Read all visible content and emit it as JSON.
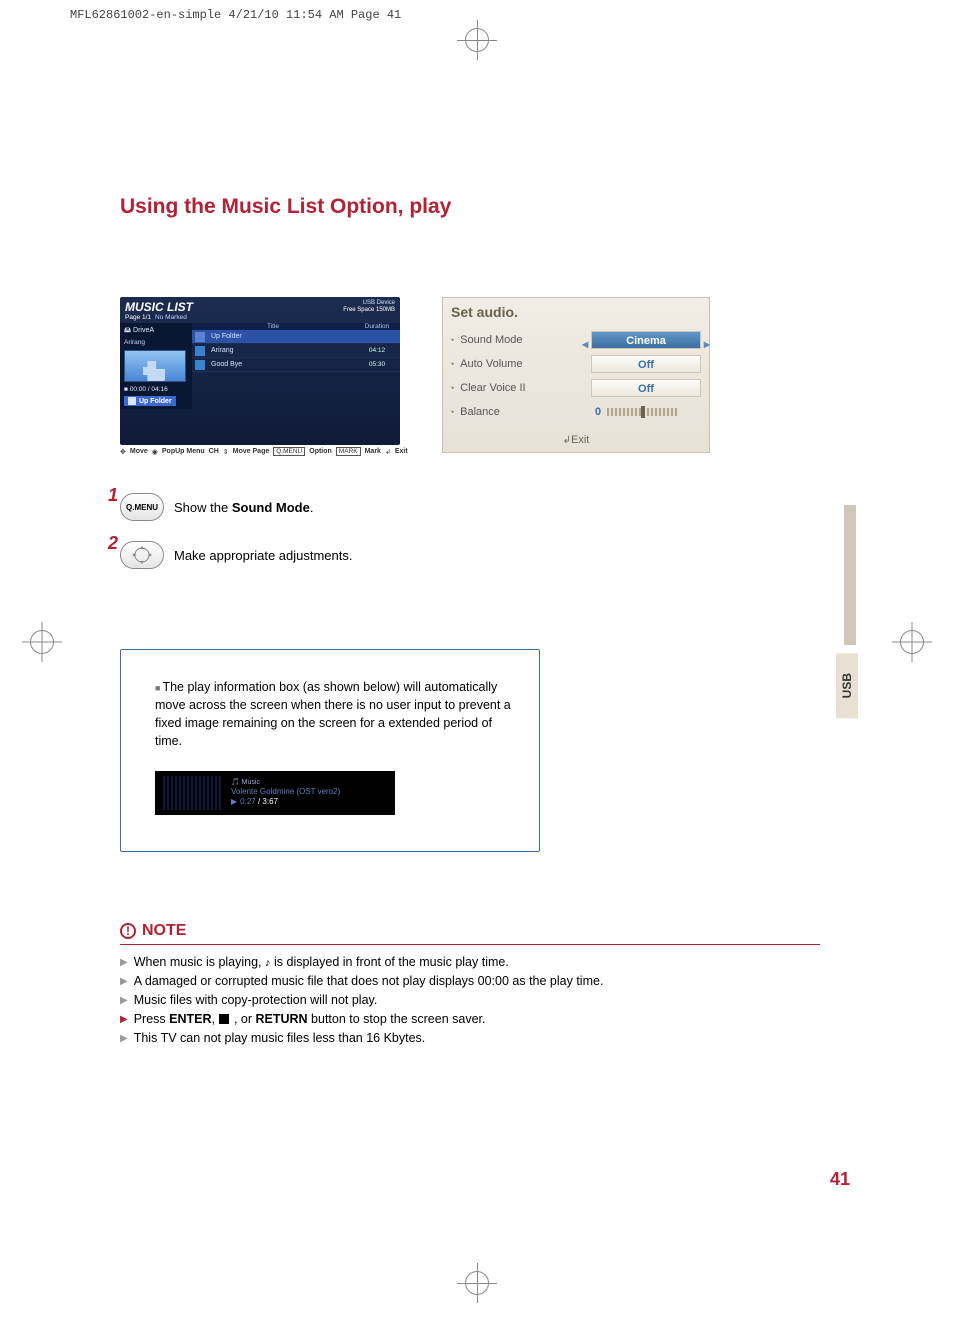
{
  "print_header": "MFL62861002-en-simple  4/21/10 11:54 AM  Page 41",
  "page_title": "Using the Music List Option, play",
  "side_tab": "USB",
  "page_number": "41",
  "music_panel": {
    "title": "MUSIC LIST",
    "page_info": "Page 1/1",
    "marked": "No Marked",
    "usb_label": "USB Device",
    "free_space": "Free Space 150MB",
    "drive_label": "DriveA",
    "drive_sub": "Arirang",
    "time_status": "■ 00:00 / 04:16",
    "up_folder_btn": "Up Folder",
    "col_title": "Title",
    "col_duration": "Duration",
    "rows": [
      {
        "name": "Up Folder",
        "duration": ""
      },
      {
        "name": "Arirang",
        "duration": "04:12"
      },
      {
        "name": "Good Bye",
        "duration": "05:30"
      }
    ],
    "hints": {
      "move": "Move",
      "popup": "PopUp Menu",
      "ch": "CH",
      "movepage": "Move Page",
      "qmenu": "Q.MENU",
      "option": "Option",
      "mark": "MARK",
      "mark2": "Mark",
      "exit": "Exit"
    }
  },
  "audio_panel": {
    "title": "Set audio.",
    "rows": {
      "sound_mode": {
        "label": "Sound Mode",
        "value": "Cinema"
      },
      "auto_volume": {
        "label": "Auto Volume",
        "value": "Off"
      },
      "clear_voice": {
        "label": "Clear Voice II",
        "value": "Off"
      },
      "balance": {
        "label": "Balance",
        "value": "0"
      }
    },
    "exit": "Exit"
  },
  "steps": {
    "s1": {
      "num": "1",
      "btn": "Q.MENU",
      "text_pre": "Show the ",
      "text_bold": "Sound Mode",
      "text_post": "."
    },
    "s2": {
      "num": "2",
      "btn_glyph": "◦",
      "text": "Make appropriate adjustments."
    }
  },
  "info_box": {
    "text": "The play information box (as shown below) will automatically move across the screen when there is no user input to prevent a fixed image remaining on the screen for a extended period of time.",
    "saver": {
      "label": "Music",
      "track": "Volente Goldmine (OST vero2)",
      "elapsed": "0:27",
      "sep": " / ",
      "total": "3:67"
    }
  },
  "note": {
    "heading": "NOTE",
    "items": {
      "n1_pre": "When music is playing, ",
      "n1_post": " is displayed in front of the music play time.",
      "n2": "A damaged or corrupted music file that does not play displays 00:00 as the play time.",
      "n3": "Music files with copy-protection will not play.",
      "n4_pre": "Press ",
      "n4_b1": "ENTER",
      "n4_mid1": ", ",
      "n4_mid2": " , or ",
      "n4_b2": "RETURN",
      "n4_post": " button to stop the screen saver.",
      "n5": "This TV can not play music files less than 16 Kbytes."
    }
  }
}
